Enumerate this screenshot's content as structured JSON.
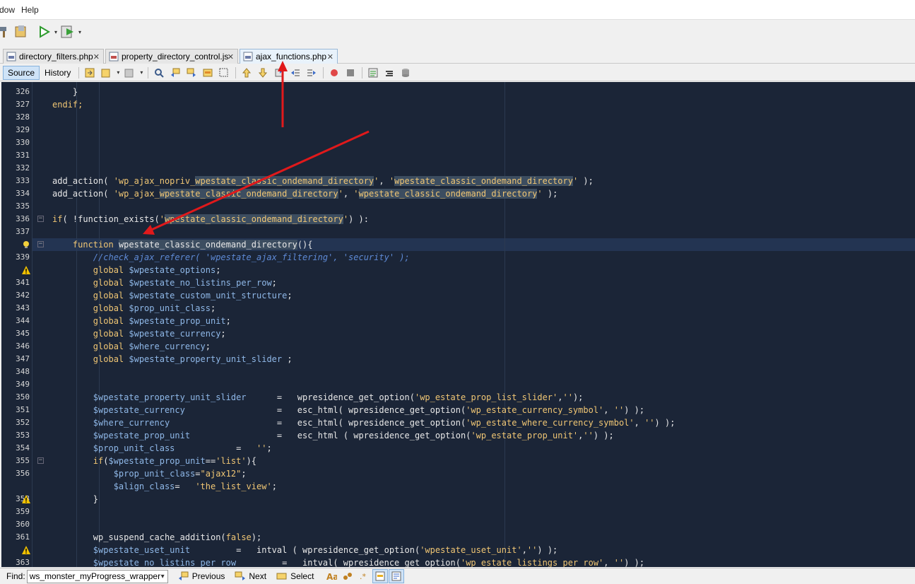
{
  "menu": {
    "items": [
      "dow",
      "Help"
    ]
  },
  "tabs": [
    {
      "label": "directory_filters.php",
      "close": "✕",
      "active": false
    },
    {
      "label": "property_directory_control.js",
      "close": "✕",
      "active": false
    },
    {
      "label": "ajax_functions.php",
      "close": "✕",
      "active": true
    }
  ],
  "editor_toolbar": {
    "source_label": "Source",
    "history_label": "History"
  },
  "lines": [
    {
      "num": "326",
      "code": [
        {
          "t": "    }",
          "c": ""
        }
      ]
    },
    {
      "num": "327",
      "code": [
        {
          "t": "endif;",
          "c": "kw"
        }
      ]
    },
    {
      "num": "328",
      "code": []
    },
    {
      "num": "329",
      "code": []
    },
    {
      "num": "330",
      "code": []
    },
    {
      "num": "331",
      "code": []
    },
    {
      "num": "332",
      "code": []
    },
    {
      "num": "333",
      "code": [
        {
          "t": "add_action( ",
          "c": ""
        },
        {
          "t": "'wp_ajax_nopriv_",
          "c": "str"
        },
        {
          "t": "wpestate_classic_ondemand_directory",
          "c": "str mark"
        },
        {
          "t": "'",
          "c": "str"
        },
        {
          "t": ", ",
          "c": ""
        },
        {
          "t": "'",
          "c": "str"
        },
        {
          "t": "wpestate_classic_ondemand_directory",
          "c": "str mark"
        },
        {
          "t": "'",
          "c": "str"
        },
        {
          "t": " );",
          "c": ""
        }
      ]
    },
    {
      "num": "334",
      "code": [
        {
          "t": "add_action( ",
          "c": ""
        },
        {
          "t": "'wp_ajax_",
          "c": "str"
        },
        {
          "t": "wpestate_classic_ondemand_directory",
          "c": "str mark"
        },
        {
          "t": "'",
          "c": "str"
        },
        {
          "t": ", ",
          "c": ""
        },
        {
          "t": "'",
          "c": "str"
        },
        {
          "t": "wpestate_classic_ondemand_directory",
          "c": "str mark"
        },
        {
          "t": "'",
          "c": "str"
        },
        {
          "t": " );",
          "c": ""
        }
      ]
    },
    {
      "num": "335",
      "code": []
    },
    {
      "num": "336",
      "code": [
        {
          "t": "if",
          "c": "kw"
        },
        {
          "t": "( !function_exists(",
          "c": ""
        },
        {
          "t": "'",
          "c": "str"
        },
        {
          "t": "wpestate_classic_ondemand_directory",
          "c": "str mark"
        },
        {
          "t": "'",
          "c": "str"
        },
        {
          "t": ") ):",
          "c": ""
        }
      ]
    },
    {
      "num": "337",
      "code": []
    },
    {
      "num": "",
      "code": [
        {
          "t": "    ",
          "c": ""
        },
        {
          "t": "function",
          "c": "kw"
        },
        {
          "t": " ",
          "c": ""
        },
        {
          "t": "wpestate_classic_ondemand_directory",
          "c": "mark"
        },
        {
          "t": "(){",
          "c": ""
        }
      ]
    },
    {
      "num": "339",
      "code": [
        {
          "t": "        //check_ajax_referer( 'wpestate_ajax_filtering', 'security' );",
          "c": "cmt"
        }
      ]
    },
    {
      "num": "",
      "code": [
        {
          "t": "        global ",
          "c": "kw"
        },
        {
          "t": "$wpestate_options",
          "c": "var"
        },
        {
          "t": ";",
          "c": ""
        }
      ]
    },
    {
      "num": "341",
      "code": [
        {
          "t": "        global ",
          "c": "kw"
        },
        {
          "t": "$wpestate_no_listins_per_row",
          "c": "var"
        },
        {
          "t": ";",
          "c": ""
        }
      ]
    },
    {
      "num": "342",
      "code": [
        {
          "t": "        global ",
          "c": "kw"
        },
        {
          "t": "$wpestate_custom_unit_structure",
          "c": "var"
        },
        {
          "t": ";",
          "c": ""
        }
      ]
    },
    {
      "num": "343",
      "code": [
        {
          "t": "        global ",
          "c": "kw"
        },
        {
          "t": "$prop_unit_class",
          "c": "var"
        },
        {
          "t": ";",
          "c": ""
        }
      ]
    },
    {
      "num": "344",
      "code": [
        {
          "t": "        global ",
          "c": "kw"
        },
        {
          "t": "$wpestate_prop_unit",
          "c": "var"
        },
        {
          "t": ";",
          "c": ""
        }
      ]
    },
    {
      "num": "345",
      "code": [
        {
          "t": "        global ",
          "c": "kw"
        },
        {
          "t": "$wpestate_currency",
          "c": "var"
        },
        {
          "t": ";",
          "c": ""
        }
      ]
    },
    {
      "num": "346",
      "code": [
        {
          "t": "        global ",
          "c": "kw"
        },
        {
          "t": "$where_currency",
          "c": "var"
        },
        {
          "t": ";",
          "c": ""
        }
      ]
    },
    {
      "num": "347",
      "code": [
        {
          "t": "        global ",
          "c": "kw"
        },
        {
          "t": "$wpestate_property_unit_slider",
          "c": "var"
        },
        {
          "t": " ;",
          "c": ""
        }
      ]
    },
    {
      "num": "348",
      "code": []
    },
    {
      "num": "349",
      "code": []
    },
    {
      "num": "350",
      "code": [
        {
          "t": "        ",
          "c": ""
        },
        {
          "t": "$wpestate_property_unit_slider",
          "c": "var"
        },
        {
          "t": "      =   wpresidence_get_option(",
          "c": ""
        },
        {
          "t": "'wp_estate_prop_list_slider'",
          "c": "str"
        },
        {
          "t": ",",
          "c": ""
        },
        {
          "t": "''",
          "c": "str"
        },
        {
          "t": ");",
          "c": ""
        }
      ]
    },
    {
      "num": "351",
      "code": [
        {
          "t": "        ",
          "c": ""
        },
        {
          "t": "$wpestate_currency",
          "c": "var"
        },
        {
          "t": "                  =   esc_html( wpresidence_get_option(",
          "c": ""
        },
        {
          "t": "'wp_estate_currency_symbol'",
          "c": "str"
        },
        {
          "t": ", ",
          "c": ""
        },
        {
          "t": "''",
          "c": "str"
        },
        {
          "t": ") );",
          "c": ""
        }
      ]
    },
    {
      "num": "352",
      "code": [
        {
          "t": "        ",
          "c": ""
        },
        {
          "t": "$where_currency",
          "c": "var"
        },
        {
          "t": "                     =   esc_html( wpresidence_get_option(",
          "c": ""
        },
        {
          "t": "'wp_estate_where_currency_symbol'",
          "c": "str"
        },
        {
          "t": ", ",
          "c": ""
        },
        {
          "t": "''",
          "c": "str"
        },
        {
          "t": ") );",
          "c": ""
        }
      ]
    },
    {
      "num": "353",
      "code": [
        {
          "t": "        ",
          "c": ""
        },
        {
          "t": "$wpestate_prop_unit",
          "c": "var"
        },
        {
          "t": "                 =   esc_html ( wpresidence_get_option(",
          "c": ""
        },
        {
          "t": "'wp_estate_prop_unit'",
          "c": "str"
        },
        {
          "t": ",",
          "c": ""
        },
        {
          "t": "''",
          "c": "str"
        },
        {
          "t": ") );",
          "c": ""
        }
      ]
    },
    {
      "num": "354",
      "code": [
        {
          "t": "        ",
          "c": ""
        },
        {
          "t": "$prop_unit_class",
          "c": "var"
        },
        {
          "t": "            =   ",
          "c": ""
        },
        {
          "t": "''",
          "c": "str"
        },
        {
          "t": ";",
          "c": ""
        }
      ]
    },
    {
      "num": "355",
      "code": [
        {
          "t": "        ",
          "c": ""
        },
        {
          "t": "if",
          "c": "kw"
        },
        {
          "t": "(",
          "c": ""
        },
        {
          "t": "$wpestate_prop_unit",
          "c": "var"
        },
        {
          "t": "==",
          "c": ""
        },
        {
          "t": "'list'",
          "c": "str"
        },
        {
          "t": "){",
          "c": ""
        }
      ]
    },
    {
      "num": "356",
      "code": [
        {
          "t": "            ",
          "c": ""
        },
        {
          "t": "$prop_unit_class",
          "c": "var"
        },
        {
          "t": "=",
          "c": ""
        },
        {
          "t": "\"ajax12\"",
          "c": "str"
        },
        {
          "t": ";",
          "c": ""
        }
      ]
    },
    {
      "num": "",
      "code": [
        {
          "t": "            ",
          "c": ""
        },
        {
          "t": "$align_class",
          "c": "var"
        },
        {
          "t": "=   ",
          "c": ""
        },
        {
          "t": "'the_list_view'",
          "c": "str"
        },
        {
          "t": ";",
          "c": ""
        }
      ]
    },
    {
      "num": "358",
      "code": [
        {
          "t": "        }",
          "c": ""
        }
      ]
    },
    {
      "num": "359",
      "code": []
    },
    {
      "num": "360",
      "code": []
    },
    {
      "num": "361",
      "code": [
        {
          "t": "        wp_suspend_cache_addition(",
          "c": ""
        },
        {
          "t": "false",
          "c": "kw"
        },
        {
          "t": ");",
          "c": ""
        }
      ]
    },
    {
      "num": "",
      "code": [
        {
          "t": "        ",
          "c": ""
        },
        {
          "t": "$wpestate_uset_unit",
          "c": "var"
        },
        {
          "t": "         =   intval ( wpresidence_get_option(",
          "c": ""
        },
        {
          "t": "'wpestate_uset_unit'",
          "c": "str"
        },
        {
          "t": ",",
          "c": ""
        },
        {
          "t": "''",
          "c": "str"
        },
        {
          "t": ") );",
          "c": ""
        }
      ]
    },
    {
      "num": "363",
      "code": [
        {
          "t": "        ",
          "c": ""
        },
        {
          "t": "$wpestate_no_listins_per_row",
          "c": "var"
        },
        {
          "t": "         =   intval( wpresidence_get_option(",
          "c": ""
        },
        {
          "t": "'wp_estate_listings_per_row'",
          "c": "str"
        },
        {
          "t": ", ",
          "c": ""
        },
        {
          "t": "''",
          "c": "str"
        },
        {
          "t": ") );",
          "c": ""
        }
      ]
    }
  ],
  "findbar": {
    "label": "Find:",
    "value": "ws_monster_myProgress_wrapper",
    "previous": "Previous",
    "next": "Next",
    "select": "Select"
  },
  "colors": {
    "editor_bg": "#1b2537",
    "keyword": "#f0c674",
    "variable": "#8fb8e8",
    "comment": "#5e8ad6",
    "annotation_arrow": "#e0191b"
  }
}
